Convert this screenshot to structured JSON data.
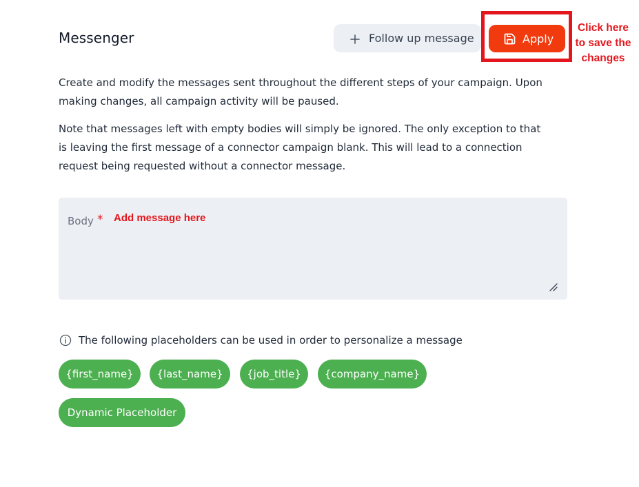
{
  "header": {
    "title": "Messenger",
    "follow_up_label": "Follow up message",
    "apply_label": "Apply"
  },
  "annotations": {
    "save_hint": "Click here to save the changes",
    "message_hint": "Add message here"
  },
  "description": {
    "paragraph_1": "Create and modify the messages sent throughout the different steps of your campaign. Upon making changes, all campaign activity will be paused.",
    "paragraph_2": "Note that messages left with empty bodies will simply be ignored. The only exception to that is leaving the first message of a connector campaign blank. This will lead to a connection request being requested without a connector message."
  },
  "body_field": {
    "label": "Body",
    "required_mark": "*",
    "value": ""
  },
  "placeholders": {
    "info_text": "The following placeholders can be used in order to personalize a message",
    "items": [
      "{first_name}",
      "{last_name}",
      "{job_title}",
      "{company_name}",
      "Dynamic Placeholder"
    ]
  },
  "colors": {
    "accent": "#f13a0e",
    "annotation": "#e3161d",
    "chip": "#4caf50"
  },
  "icons": {
    "follow_up": "plus-icon",
    "apply": "save-icon",
    "info": "info-icon",
    "resize": "resize-handle-icon"
  }
}
